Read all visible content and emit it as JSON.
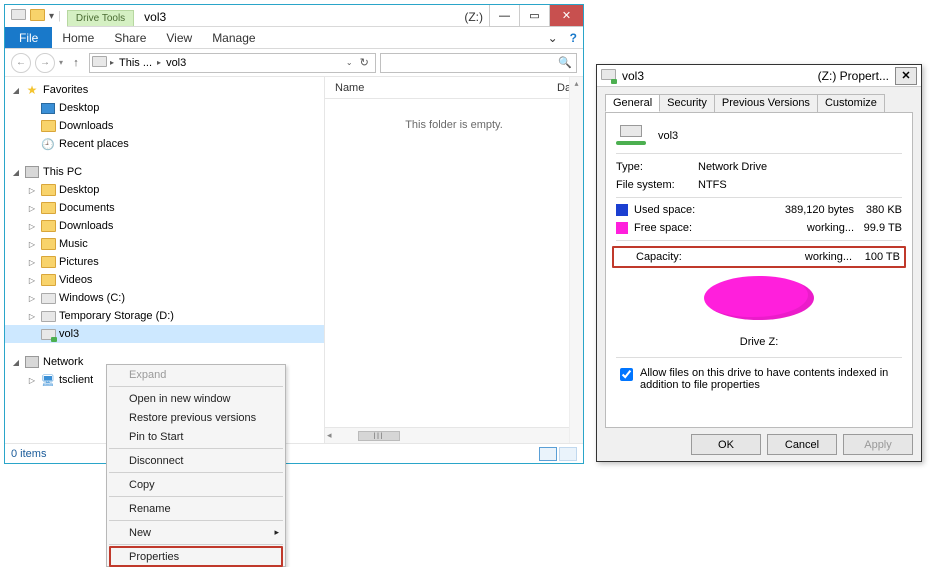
{
  "explorer": {
    "drive_tools_label": "Drive Tools",
    "title": "vol3",
    "drive": "(Z:)",
    "ribbon": {
      "file": "File",
      "home": "Home",
      "share": "Share",
      "view": "View",
      "manage": "Manage"
    },
    "address": {
      "seg1": "This ...",
      "seg2": "vol3"
    },
    "columns": {
      "name": "Name",
      "date": "Da"
    },
    "empty": "This folder is empty.",
    "status": "0 items",
    "hscroll_caption": "III"
  },
  "tree": {
    "favorites": "Favorites",
    "desktop": "Desktop",
    "downloads_fav": "Downloads",
    "recent": "Recent places",
    "thispc": "This PC",
    "desktop2": "Desktop",
    "documents": "Documents",
    "downloads": "Downloads",
    "music": "Music",
    "pictures": "Pictures",
    "videos": "Videos",
    "c_drive": "Windows (C:)",
    "d_drive": "Temporary Storage (D:)",
    "vol3": "vol3",
    "network": "Network",
    "tsclient": "tsclient"
  },
  "context": {
    "expand": "Expand",
    "open_new": "Open in new window",
    "restore": "Restore previous versions",
    "pin": "Pin to Start",
    "disconnect": "Disconnect",
    "copy": "Copy",
    "rename": "Rename",
    "new": "New",
    "properties": "Properties"
  },
  "props": {
    "title_left": "vol3",
    "title_right": "(Z:) Propert...",
    "tabs": {
      "general": "General",
      "security": "Security",
      "prev": "Previous Versions",
      "customize": "Customize"
    },
    "name": "vol3",
    "type_label": "Type:",
    "type_val": "Network Drive",
    "fs_label": "File system:",
    "fs_val": "NTFS",
    "used_label": "Used space:",
    "used_bytes": "389,120 bytes",
    "used_size": "380 KB",
    "free_label": "Free space:",
    "free_bytes": "working...",
    "free_size": "99.9 TB",
    "capacity_label": "Capacity:",
    "capacity_bytes": "working...",
    "capacity_size": "100 TB",
    "drive_caption": "Drive Z:",
    "index_text": "Allow files on this drive to have contents indexed in addition to file properties",
    "ok": "OK",
    "cancel": "Cancel",
    "apply": "Apply"
  }
}
